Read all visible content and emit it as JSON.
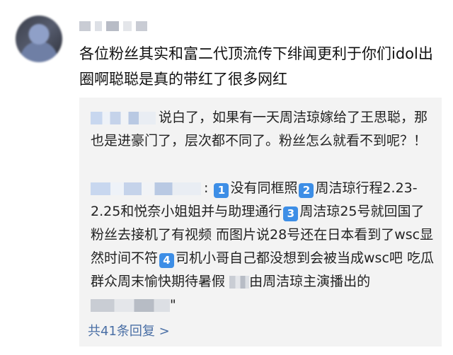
{
  "comment": {
    "text": "各位粉丝其实和富二代顶流传下绯闻更利于你们idol出圈啊聪聪是真的带红了很多网红"
  },
  "replies": [
    {
      "text": "说白了，如果有一天周洁琼嫁给了王思聪，那也是进豪门了，层次都不同了。粉丝怎么就看不到呢？！"
    },
    {
      "sep": ":",
      "badges": [
        "1",
        "2",
        "3",
        "4"
      ],
      "seg1": "没有同框照",
      "seg2": "周洁琼行程2.23-2.25和悦奈小姐姐并与助理通行",
      "seg3": "周洁琼25号就回国了 粉丝去接机了有视频 而图片说28号还在日本看到了wsc显然时间不符",
      "seg4": "司机小哥自己都没想到会被当成wsc吧 吃瓜群众周末愉快期待暑假",
      "seg5": "由周洁琼主演播出的",
      "tail": "\""
    }
  ],
  "more_replies_label": "共41条回复 >"
}
